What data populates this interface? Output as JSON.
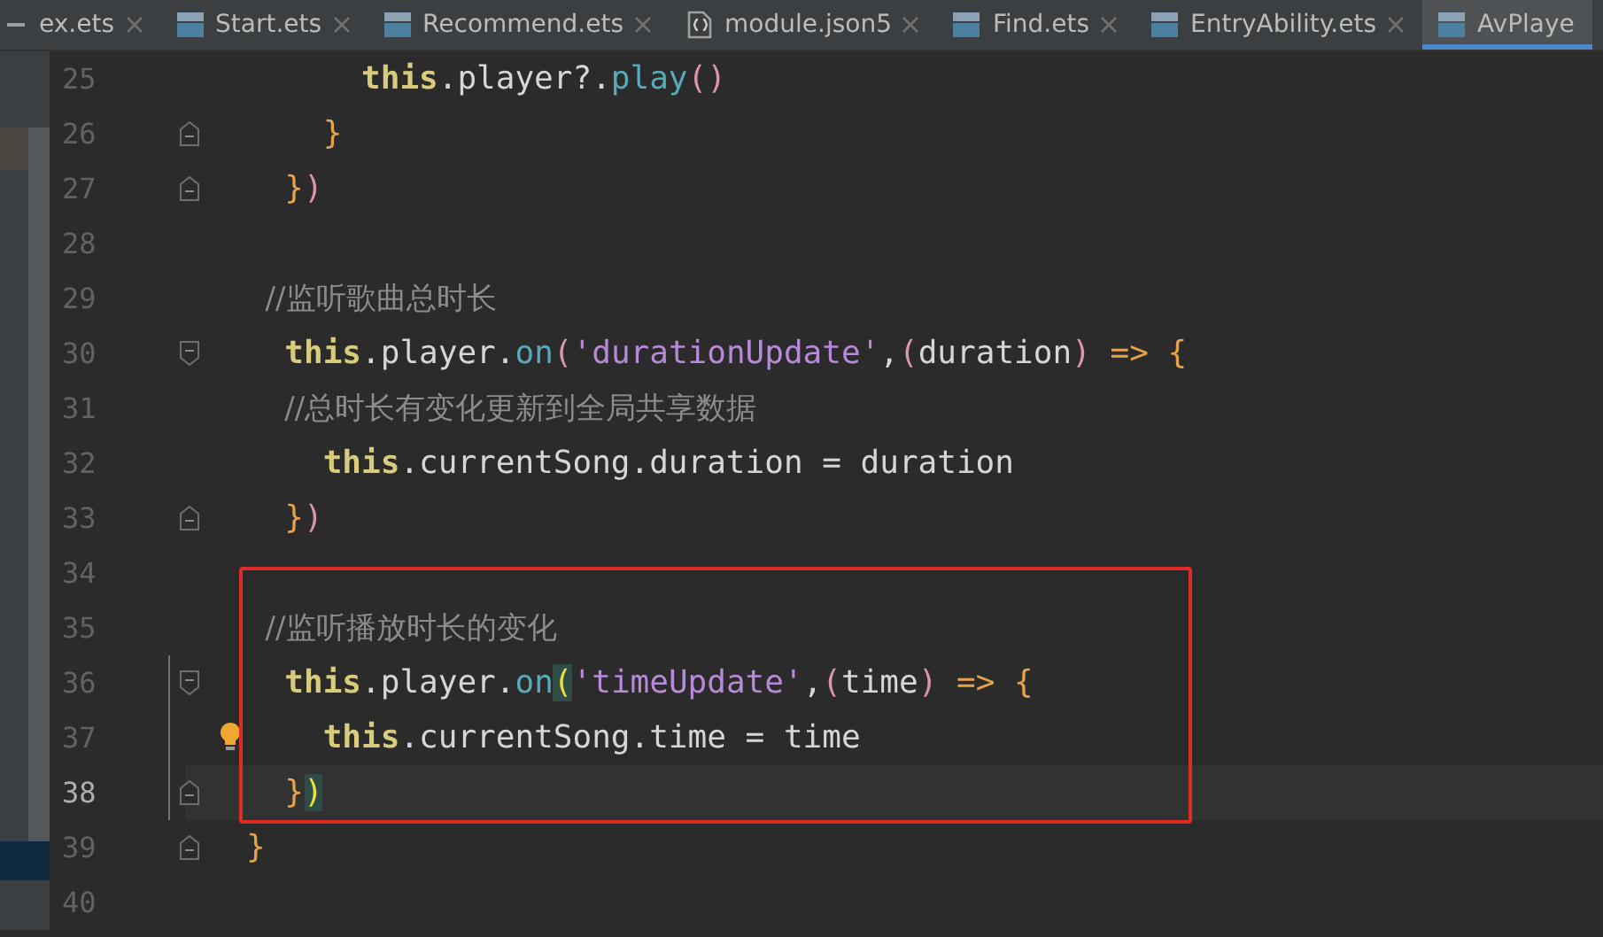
{
  "tabs": [
    {
      "label": "ex.ets",
      "kind": "plain",
      "selected": false
    },
    {
      "label": "Start.ets",
      "kind": "ets",
      "selected": false
    },
    {
      "label": "Recommend.ets",
      "kind": "ets",
      "selected": false
    },
    {
      "label": "module.json5",
      "kind": "json",
      "selected": false
    },
    {
      "label": "Find.ets",
      "kind": "ets",
      "selected": false
    },
    {
      "label": "EntryAbility.ets",
      "kind": "ets",
      "selected": false
    },
    {
      "label": "AvPlaye",
      "kind": "ets",
      "selected": true
    }
  ],
  "lines": [
    {
      "number": "25",
      "kind": "plain",
      "current": false,
      "highlighted": false,
      "changed": false,
      "bulb": false,
      "tokens": [
        {
          "kind": "keyword",
          "text": "      this"
        },
        {
          "kind": "plain",
          "text": ".player?."
        },
        {
          "kind": "method",
          "text": "play"
        },
        {
          "kind": "paren",
          "text": "()"
        }
      ]
    },
    {
      "number": "26",
      "kind": "fold_end",
      "current": false,
      "highlighted": false,
      "changed": false,
      "bulb": false,
      "tokens": [
        {
          "kind": "brace",
          "text": "    }"
        }
      ]
    },
    {
      "number": "27",
      "kind": "fold_end",
      "current": false,
      "highlighted": false,
      "changed": false,
      "bulb": false,
      "tokens": [
        {
          "kind": "brace",
          "text": "  }"
        },
        {
          "kind": "paren",
          "text": ")"
        }
      ]
    },
    {
      "number": "28",
      "kind": "plain",
      "current": false,
      "highlighted": false,
      "changed": false,
      "bulb": false
    },
    {
      "number": "29",
      "kind": "plain",
      "current": false,
      "highlighted": false,
      "changed": false,
      "bulb": false,
      "tokens": [
        {
          "kind": "comment",
          "text": "  //监听歌曲总时长"
        }
      ]
    },
    {
      "number": "30",
      "kind": "fold_start",
      "current": false,
      "highlighted": false,
      "changed": false,
      "bulb": false,
      "tokens": [
        {
          "kind": "keyword",
          "text": "  this"
        },
        {
          "kind": "plain",
          "text": ".player."
        },
        {
          "kind": "method",
          "text": "on"
        },
        {
          "kind": "paren",
          "text": "("
        },
        {
          "kind": "string",
          "text": "'durationUpdate'"
        },
        {
          "kind": "plain",
          "text": ","
        },
        {
          "kind": "paren",
          "text": "("
        },
        {
          "kind": "plain",
          "text": "duration"
        },
        {
          "kind": "paren",
          "text": ")"
        },
        {
          "kind": "brace",
          "text": " => {"
        }
      ]
    },
    {
      "number": "31",
      "kind": "plain",
      "current": false,
      "highlighted": false,
      "changed": false,
      "bulb": false,
      "tokens": [
        {
          "kind": "comment",
          "text": "    //总时长有变化更新到全局共享数据"
        }
      ]
    },
    {
      "number": "32",
      "kind": "plain",
      "current": false,
      "highlighted": false,
      "changed": false,
      "bulb": false,
      "tokens": [
        {
          "kind": "keyword",
          "text": "    this"
        },
        {
          "kind": "plain",
          "text": ".currentSong.duration = duration"
        }
      ]
    },
    {
      "number": "33",
      "kind": "fold_end",
      "current": false,
      "highlighted": false,
      "changed": false,
      "bulb": false,
      "tokens": [
        {
          "kind": "brace",
          "text": "  }"
        },
        {
          "kind": "paren",
          "text": ")"
        }
      ]
    },
    {
      "number": "34",
      "kind": "plain",
      "current": false,
      "highlighted": false,
      "changed": false,
      "bulb": false
    },
    {
      "number": "35",
      "kind": "plain",
      "current": false,
      "highlighted": true,
      "changed": false,
      "bulb": false,
      "tokens": [
        {
          "kind": "comment",
          "text": "  //监听播放时长的变化"
        }
      ]
    },
    {
      "number": "36",
      "kind": "fold_start",
      "current": false,
      "highlighted": true,
      "changed": true,
      "bulb": false,
      "tokens": [
        {
          "kind": "keyword",
          "text": "  this"
        },
        {
          "kind": "plain",
          "text": ".player."
        },
        {
          "kind": "method",
          "text": "on"
        },
        {
          "kind": "match",
          "text": "("
        },
        {
          "kind": "string",
          "text": "'timeUpdate'"
        },
        {
          "kind": "plain",
          "text": ","
        },
        {
          "kind": "paren",
          "text": "("
        },
        {
          "kind": "plain",
          "text": "time"
        },
        {
          "kind": "paren",
          "text": ")"
        },
        {
          "kind": "brace",
          "text": " => {"
        }
      ]
    },
    {
      "number": "37",
      "kind": "plain",
      "current": false,
      "highlighted": true,
      "changed": true,
      "bulb": true,
      "tokens": [
        {
          "kind": "keyword",
          "text": "    this"
        },
        {
          "kind": "plain",
          "text": ".currentSong.time = time"
        }
      ]
    },
    {
      "number": "38",
      "kind": "fold_end",
      "current": true,
      "highlighted": true,
      "changed": true,
      "bulb": false,
      "tokens": [
        {
          "kind": "brace",
          "text": "  }"
        },
        {
          "kind": "match",
          "text": ")"
        }
      ]
    },
    {
      "number": "39",
      "kind": "fold_end",
      "current": false,
      "highlighted": false,
      "changed": false,
      "bulb": false,
      "tokens": [
        {
          "kind": "brace",
          "text": "}"
        }
      ]
    },
    {
      "number": "40",
      "kind": "plain",
      "current": false,
      "highlighted": false,
      "changed": false,
      "bulb": false
    }
  ]
}
